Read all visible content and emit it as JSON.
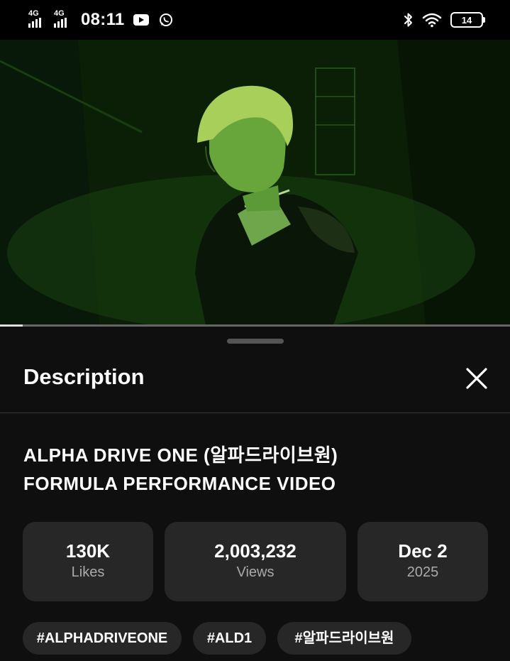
{
  "status_bar": {
    "signal_1": "4G",
    "signal_2": "4G",
    "time": "08:11",
    "notification_icons": [
      "youtube-icon",
      "whatsapp-icon"
    ],
    "right_icons": [
      "bluetooth-icon",
      "wifi-icon",
      "battery-icon"
    ],
    "battery_level": "14"
  },
  "video": {
    "progress_fraction": 0.045,
    "tint_color": "#1c4a12"
  },
  "description_panel": {
    "title": "Description",
    "close_icon": "close-icon",
    "video_title_line1": "ALPHA DRIVE ONE (알파드라이브원)",
    "video_title_line2": "FORMULA PERFORMANCE VIDEO",
    "stats": [
      {
        "value": "130K",
        "label": "Likes"
      },
      {
        "value": "2,003,232",
        "label": "Views"
      },
      {
        "value": "Dec 2",
        "label": "2025"
      }
    ],
    "hashtags": [
      "#ALPHADRIVEONE",
      "#ALD1",
      "#알파드라이브원"
    ]
  }
}
